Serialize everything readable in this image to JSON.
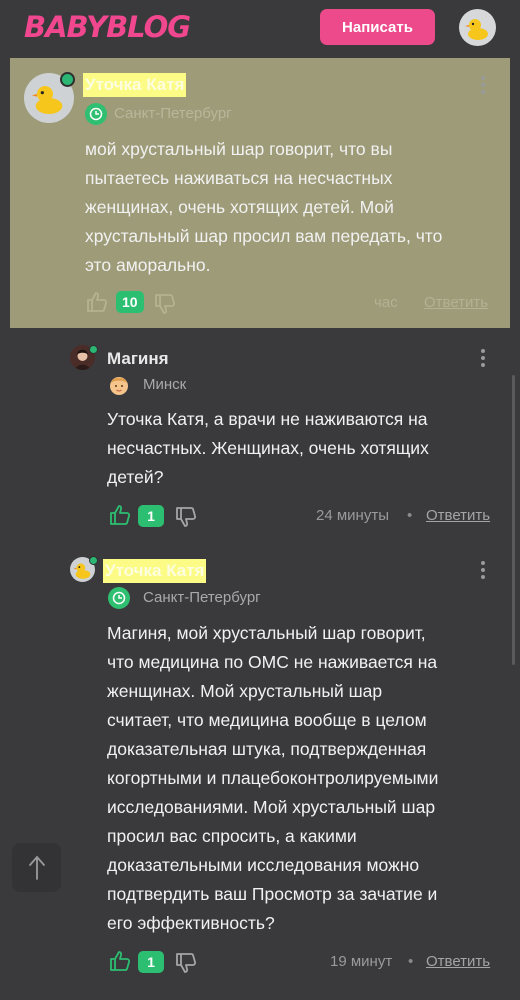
{
  "header": {
    "logo": "BABYBLOG",
    "write_label": "Написать",
    "avatar_icon": "duck-avatar-icon"
  },
  "colors": {
    "background": "#3a3a3c",
    "accent": "#ec4a8a",
    "highlight": "#9d9b78",
    "author_highlight": "#fbfb86",
    "like_badge": "#2dbf71"
  },
  "comments": [
    {
      "author": "Уточка Катя",
      "city": "Санкт-Петербург",
      "text_lines": [
        "мой хрустальный шар говорит, что вы",
        "пытаетесь наживаться на несчастных",
        "женщинах, очень хотящих детей. Мой",
        "хрустальный шар просил вам передать, что",
        "это аморально."
      ],
      "likes": "10",
      "time": "час",
      "reply": "Ответить",
      "highlighted": true
    },
    {
      "author": "Магиня",
      "city": "Минск",
      "text_lines": [
        "Уточка Катя, а врачи не наживаются на",
        "несчастных. Женщинах, очень хотящих",
        "детей?"
      ],
      "likes": "1",
      "time": "24 минуты",
      "separator": "•",
      "reply": "Ответить"
    },
    {
      "author": "Уточка Катя",
      "city": "Санкт-Петербург",
      "text_lines": [
        "Магиня, мой хрустальный шар говорит,",
        "что медицина по ОМС не наживается на",
        "женщинах. Мой хрустальный шар",
        "считает, что медицина вообще в целом",
        "доказательная штука, подтвержденная",
        "когортными и плацебоконтролируемыми",
        "исследованиями. Мой хрустальный шар",
        "просил вас спросить, а какими",
        "доказательными исследования можно",
        "подтвердить ваш Просмотр за зачатие и",
        "его эффективность?"
      ],
      "likes": "1",
      "time": "19 минут",
      "separator": "•",
      "reply": "Ответить"
    }
  ]
}
